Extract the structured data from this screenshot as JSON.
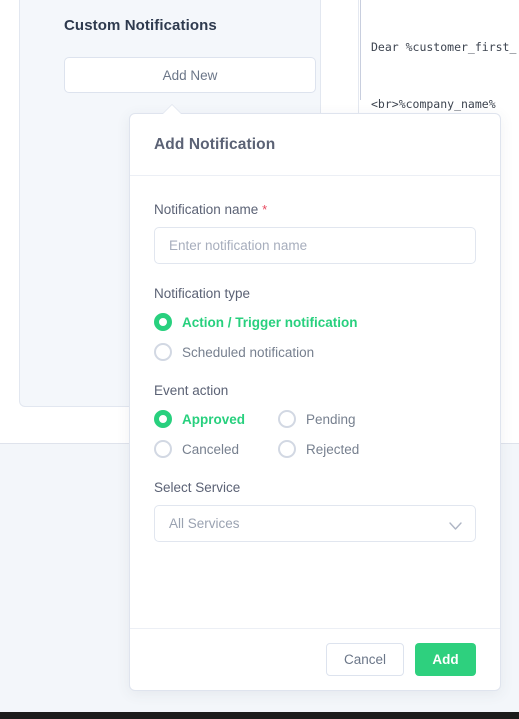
{
  "background": {
    "page_bg": "#f3f6fa",
    "card_bg": "#f4f7fb",
    "accent_green": "#2ed07e",
    "required_red": "#e8495f"
  },
  "left_panel": {
    "card_title": "Custom Notifications",
    "add_new_label": "Add New"
  },
  "code_snippet": {
    "lines": [
      "Dear %customer_first_",
      "<br>%company_name%"
    ]
  },
  "modal": {
    "title": "Add Notification",
    "fields": {
      "notification_name": {
        "label": "Notification name",
        "required_marker": "*",
        "value": "",
        "placeholder": "Enter notification name"
      },
      "notification_type": {
        "label": "Notification type",
        "options": [
          {
            "label": "Action / Trigger notification",
            "selected": true
          },
          {
            "label": "Scheduled notification",
            "selected": false
          }
        ]
      },
      "event_action": {
        "label": "Event action",
        "options": [
          {
            "label": "Approved",
            "selected": true
          },
          {
            "label": "Pending",
            "selected": false
          },
          {
            "label": "Canceled",
            "selected": false
          },
          {
            "label": "Rejected",
            "selected": false
          }
        ]
      },
      "select_service": {
        "label": "Select Service",
        "selected_value": "All Services",
        "chevron_icon": "chevron-down-icon"
      }
    },
    "footer": {
      "cancel_label": "Cancel",
      "add_label": "Add"
    }
  }
}
